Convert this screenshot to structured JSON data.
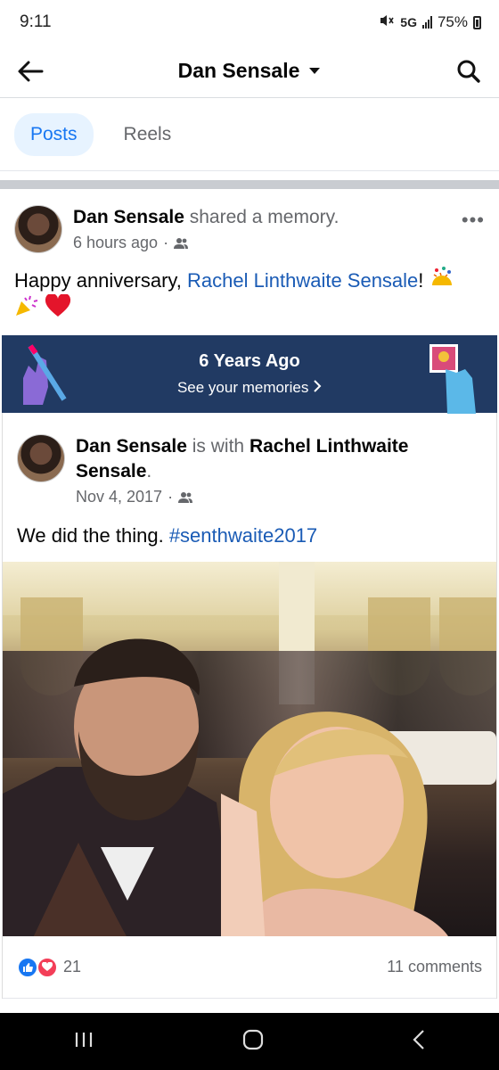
{
  "status": {
    "time": "9:11",
    "network": "5G",
    "battery": "75%"
  },
  "header": {
    "title": "Dan Sensale"
  },
  "tabs": [
    {
      "label": "Posts"
    },
    {
      "label": "Reels"
    }
  ],
  "post": {
    "author": "Dan Sensale",
    "action": "shared a memory.",
    "time": "6 hours ago",
    "text_prefix": "Happy anniversary, ",
    "mention": "Rachel Linthwaite Sensale",
    "text_suffix": "!"
  },
  "memory": {
    "title": "6 Years Ago",
    "subtitle": "See your memories"
  },
  "shared": {
    "author": "Dan Sensale",
    "with_text": "is with",
    "tagged_line1": "Rachel Linthwaite",
    "tagged_line2": "Sensale",
    "date": "Nov 4, 2017",
    "text": "We did the thing. ",
    "hashtag": "#senthwaite2017"
  },
  "reactions": {
    "count": "21",
    "comments": "11 comments"
  },
  "colors": {
    "accent": "#1877f2",
    "banner": "#213a63",
    "link": "#1a5bb5"
  }
}
